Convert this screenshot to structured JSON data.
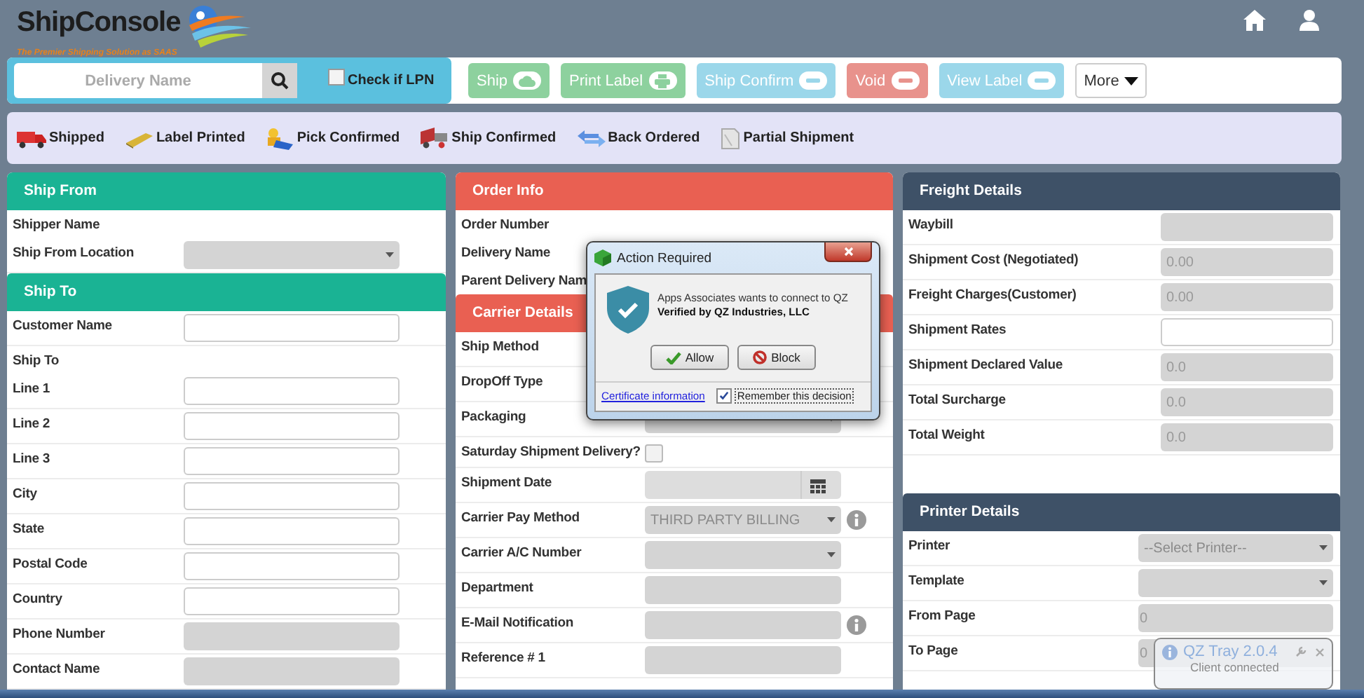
{
  "header": {
    "logo": "ShipConsole",
    "tagline": "The Premier Shipping Solution as SAAS"
  },
  "search": {
    "placeholder": "Delivery Name"
  },
  "lpn": {
    "label": "Check if LPN",
    "checked": false
  },
  "actions": [
    {
      "label": "Ship",
      "kind": "success"
    },
    {
      "label": "Print Label",
      "kind": "success"
    },
    {
      "label": "Ship Confirm",
      "kind": "info"
    },
    {
      "label": "Void",
      "kind": "danger"
    },
    {
      "label": "View Label",
      "kind": "info"
    },
    {
      "label": "More",
      "kind": "dropdown"
    }
  ],
  "legend": [
    "Shipped",
    "Label Printed",
    "Pick Confirmed",
    "Ship Confirmed",
    "Back Ordered",
    "Partial Shipment"
  ],
  "columns": [
    {
      "sections": [
        {
          "title": "Ship From",
          "color": "#1ab394",
          "rows": [
            {
              "label": "Shipper Name",
              "kind": "label"
            },
            {
              "label": "Ship From Location",
              "kind": "select"
            }
          ]
        },
        {
          "title": "Ship To",
          "color": "#1ab394",
          "rows": [
            {
              "label": "Customer Name",
              "kind": "text"
            },
            {
              "label": "Ship To",
              "kind": "label"
            },
            {
              "label": "Line 1",
              "kind": "text"
            },
            {
              "label": "Line 2",
              "kind": "text"
            },
            {
              "label": "Line 3",
              "kind": "text"
            },
            {
              "label": "City",
              "kind": "text"
            },
            {
              "label": "State",
              "kind": "text"
            },
            {
              "label": "Postal Code",
              "kind": "text"
            },
            {
              "label": "Country",
              "kind": "text"
            },
            {
              "label": "Phone Number",
              "kind": "readonly"
            },
            {
              "label": "Contact Name",
              "kind": "readonly"
            }
          ]
        }
      ]
    },
    {
      "sections": [
        {
          "title": "Order Info",
          "color": "#e96052",
          "rows": [
            {
              "label": "Order Number",
              "kind": "label"
            },
            {
              "label": "Delivery Name",
              "kind": "label"
            },
            {
              "label": "Parent Delivery Nam",
              "kind": "label"
            }
          ]
        },
        {
          "title": "Carrier Details",
          "color": "#e96052",
          "rows": [
            {
              "label": "Ship Method",
              "kind": "covered",
              "info": false
            },
            {
              "label": "DropOff Type",
              "kind": "covered",
              "info": false
            },
            {
              "label": "Packaging",
              "kind": "select",
              "info": false
            },
            {
              "label": "Saturday Shipment Delivery?",
              "kind": "checkbox",
              "checked": false,
              "info": false
            },
            {
              "label": "Shipment Date",
              "kind": "date",
              "info": false
            },
            {
              "label": "Carrier Pay Method",
              "kind": "select",
              "value": "THIRD PARTY BILLING",
              "info": true
            },
            {
              "label": "Carrier A/C Number",
              "kind": "select",
              "info": false
            },
            {
              "label": "Department",
              "kind": "readonly",
              "info": false
            },
            {
              "label": "E-Mail Notification",
              "kind": "readonly",
              "info": true
            },
            {
              "label": "Reference # 1",
              "kind": "readonly",
              "info": false
            }
          ]
        }
      ]
    },
    {
      "sections": [
        {
          "title": "Freight Details",
          "color": "#3e5167",
          "rows": [
            {
              "label": "Waybill",
              "kind": "readonly"
            },
            {
              "label": "Shipment Cost (Negotiated)",
              "kind": "readonly",
              "value": "0.00"
            },
            {
              "label": "Freight Charges(Customer)",
              "kind": "readonly",
              "value": "0.00"
            },
            {
              "label": "Shipment Rates",
              "kind": "text"
            },
            {
              "label": "Shipment Declared Value",
              "kind": "readonly",
              "value": "0.0"
            },
            {
              "label": "Total Surcharge",
              "kind": "readonly",
              "value": "0.0"
            },
            {
              "label": "Total Weight",
              "kind": "readonly",
              "value": "0.0"
            }
          ]
        },
        {
          "title": "Printer Details",
          "color": "#3e5167",
          "rows": [
            {
              "label": "Printer",
              "kind": "select",
              "value": "--Select Printer--"
            },
            {
              "label": "Template",
              "kind": "select"
            },
            {
              "label": "From Page",
              "kind": "readonly",
              "value": "0"
            },
            {
              "label": "To Page",
              "kind": "readonly",
              "value": "0"
            }
          ]
        }
      ]
    }
  ],
  "dialog": {
    "title": "Action Required",
    "message": "Apps Associates wants to connect to QZ",
    "verified": "Verified by QZ Industries, LLC",
    "buttons": [
      "Allow",
      "Block"
    ],
    "link": "Certificate information",
    "remember": {
      "label": "Remember this decision",
      "checked": true
    }
  },
  "tray": {
    "title": "QZ Tray 2.0.4",
    "message": "Client connected"
  }
}
